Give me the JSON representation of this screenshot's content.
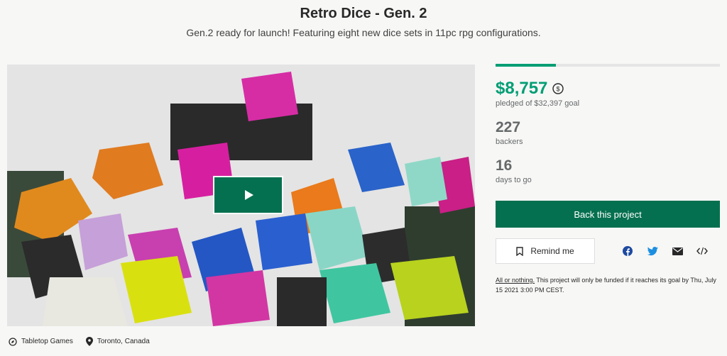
{
  "project": {
    "title": "Retro Dice - Gen. 2",
    "blurb": "Gen.2 ready for launch! Featuring eight new dice sets in 11pc rpg configurations."
  },
  "media": {
    "play_label": "Play video"
  },
  "meta": {
    "category": "Tabletop Games",
    "location": "Toronto, Canada"
  },
  "funding": {
    "progress_fraction": 0.27,
    "pledged": "$8,757",
    "pledged_goal_text": "pledged of $32,397 goal",
    "backers_count": "227",
    "backers_label": "backers",
    "days_count": "16",
    "days_label": "days to go"
  },
  "actions": {
    "back_label": "Back this project",
    "remind_label": "Remind me"
  },
  "fine_print": {
    "link": "All or nothing.",
    "text": " This project will only be funded if it reaches its goal by Thu, July 15 2021 3:00 PM CEST."
  },
  "colors": {
    "accent": "#009e74",
    "button": "#05704f"
  }
}
